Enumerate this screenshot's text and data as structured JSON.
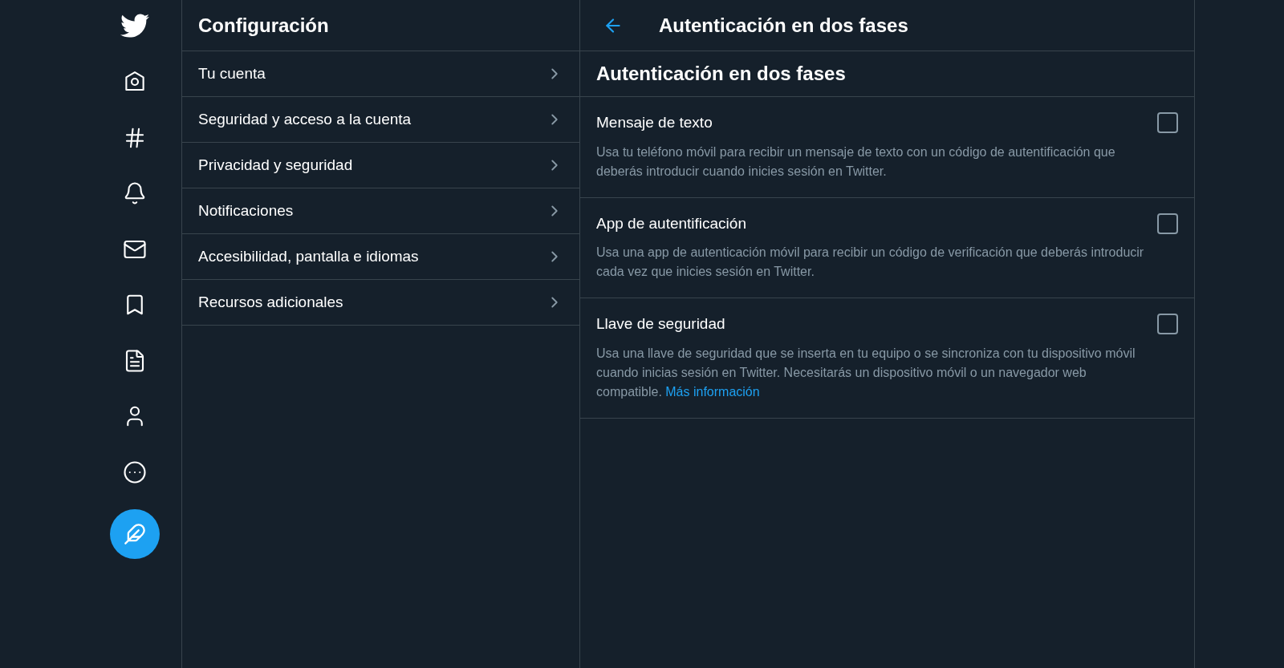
{
  "settings": {
    "title": "Configuración",
    "items": [
      {
        "label": "Tu cuenta"
      },
      {
        "label": "Seguridad y acceso a la cuenta"
      },
      {
        "label": "Privacidad y seguridad"
      },
      {
        "label": "Notificaciones"
      },
      {
        "label": "Accesibilidad, pantalla e idiomas"
      },
      {
        "label": "Recursos adicionales"
      }
    ]
  },
  "detail": {
    "title": "Autenticación en dos fases",
    "heading": "Autenticación en dos fases",
    "options": [
      {
        "title": "Mensaje de texto",
        "description": "Usa tu teléfono móvil para recibir un mensaje de texto con un código de autentificación que deberás introducir cuando inicies sesión en Twitter.",
        "checked": false
      },
      {
        "title": "App de autentificación",
        "description": "Usa una app de autenticación móvil para recibir un código de verificación que deberás introducir cada vez que inicies sesión en Twitter.",
        "checked": false
      },
      {
        "title": "Llave de seguridad",
        "description": "Usa una llave de seguridad que se inserta en tu equipo o se sincroniza con tu dispositivo móvil cuando inicias sesión en Twitter. Necesitarás un dispositivo móvil o un navegador web compatible.",
        "link": "Más información",
        "checked": false
      }
    ]
  }
}
